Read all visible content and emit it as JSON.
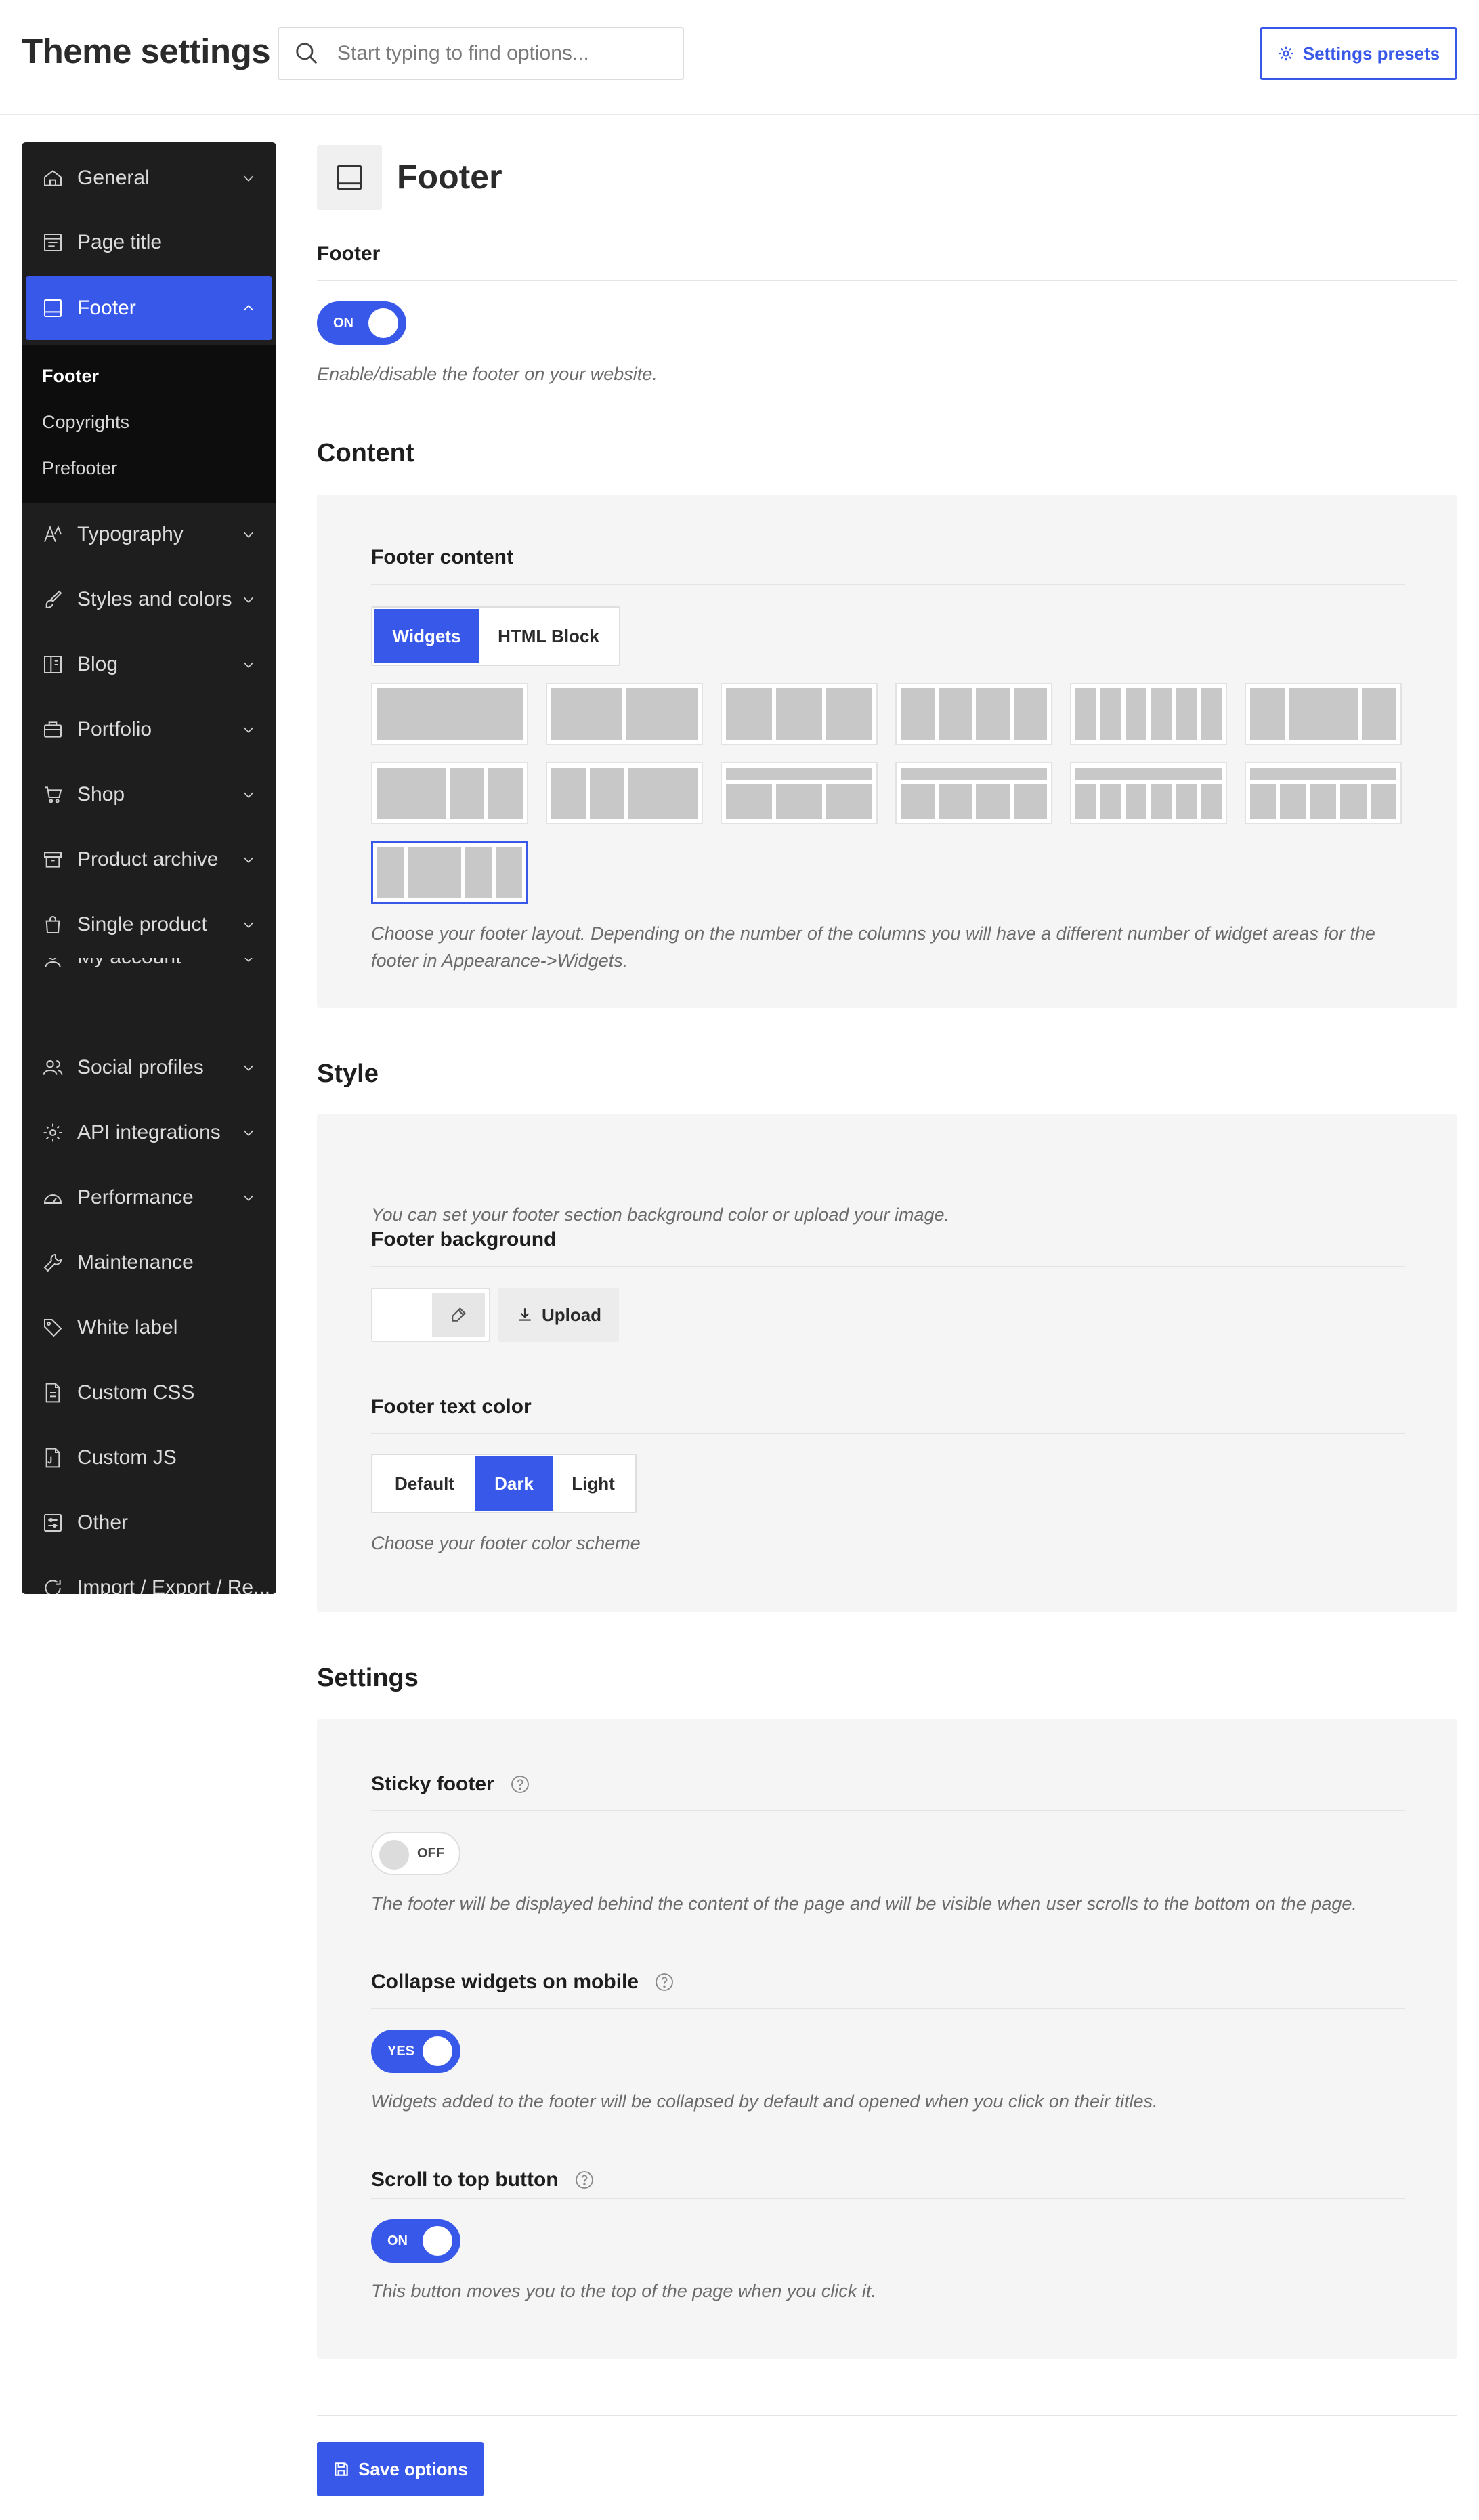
{
  "header": {
    "title": "Theme settings",
    "search_placeholder": "Start typing to find options...",
    "presets_label": "Settings presets"
  },
  "sidebar": {
    "items": [
      {
        "label": "General",
        "icon": "home-icon",
        "chevron": "down"
      },
      {
        "label": "Page title",
        "icon": "page-title-icon",
        "chevron": "none"
      },
      {
        "label": "Footer",
        "icon": "footer-icon",
        "chevron": "up",
        "active": true
      },
      {
        "label": "Typography",
        "icon": "typography-icon",
        "chevron": "down"
      },
      {
        "label": "Styles and colors",
        "icon": "brush-icon",
        "chevron": "down"
      },
      {
        "label": "Blog",
        "icon": "blog-icon",
        "chevron": "down"
      },
      {
        "label": "Portfolio",
        "icon": "briefcase-icon",
        "chevron": "down"
      },
      {
        "label": "Shop",
        "icon": "cart-icon",
        "chevron": "down"
      },
      {
        "label": "Product archive",
        "icon": "archive-icon",
        "chevron": "down"
      },
      {
        "label": "Single product",
        "icon": "bag-icon",
        "chevron": "down"
      },
      {
        "label": "My account",
        "icon": "user-icon",
        "chevron": "down"
      },
      {
        "label": "Social profiles",
        "icon": "users-icon",
        "chevron": "down"
      },
      {
        "label": "API integrations",
        "icon": "gear-icon",
        "chevron": "down"
      },
      {
        "label": "Performance",
        "icon": "gauge-icon",
        "chevron": "down"
      },
      {
        "label": "Maintenance",
        "icon": "wrench-icon",
        "chevron": "none"
      },
      {
        "label": "White label",
        "icon": "tag-icon",
        "chevron": "none"
      },
      {
        "label": "Custom CSS",
        "icon": "css-file-icon",
        "chevron": "none"
      },
      {
        "label": "Custom JS",
        "icon": "js-file-icon",
        "chevron": "none"
      },
      {
        "label": "Other",
        "icon": "sliders-icon",
        "chevron": "none"
      },
      {
        "label": "Import / Export / Re...",
        "icon": "refresh-icon",
        "chevron": "none"
      }
    ],
    "sub_items": [
      "Footer",
      "Copyrights",
      "Prefooter"
    ],
    "current_sub": "Footer"
  },
  "page": {
    "title": "Footer",
    "footer_label": "Footer",
    "footer_toggle": "ON",
    "footer_desc": "Enable/disable the footer on your website."
  },
  "content": {
    "heading": "Content",
    "field_label": "Footer content",
    "tabs": [
      "Widgets",
      "HTML Block"
    ],
    "active_tab": "Widgets",
    "layout_selected_index": 12,
    "desc": "Choose your footer layout. Depending on the number of the columns you will have a different number of widget areas for the footer in Appearance->Widgets."
  },
  "style": {
    "heading": "Style",
    "bg_note": "You can set your footer section background color or upload your image.",
    "bg_label": "Footer background",
    "upload_label": "Upload",
    "text_color_label": "Footer text color",
    "scheme_options": [
      "Default",
      "Dark",
      "Light"
    ],
    "scheme_selected": "Dark",
    "scheme_desc": "Choose your footer color scheme"
  },
  "settings": {
    "heading": "Settings",
    "sticky_label": "Sticky footer",
    "sticky_toggle": "OFF",
    "sticky_desc": "The footer will be displayed behind the content of the page and will be visible when user scrolls to the bottom on the page.",
    "collapse_label": "Collapse widgets on mobile",
    "collapse_toggle": "YES",
    "collapse_desc": "Widgets added to the footer will be collapsed by default and opened when you click on their titles.",
    "scroll_label": "Scroll to top button",
    "scroll_toggle": "ON",
    "scroll_desc": "This button moves you to the top of the page when you click it."
  },
  "actions": {
    "save_label": "Save options"
  },
  "colors": {
    "accent": "#3858e9",
    "sidebar_bg": "#1e1e1e",
    "panel_bg": "#f5f5f5"
  }
}
